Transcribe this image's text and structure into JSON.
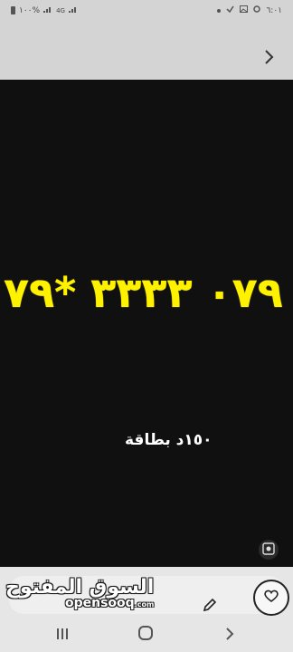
{
  "status_bar": {
    "time": "٦:٠١",
    "battery": "١٠٠%",
    "network": "4G"
  },
  "content": {
    "phone_number": "٠٧٩ ٣٣٣٣ *٧٩",
    "price": "١٥٠د بطاقة"
  },
  "brand": {
    "arabic": "السوق المفتوح",
    "latin": "opensooq",
    "latin_suffix": ".com"
  },
  "colors": {
    "number": "#fff200",
    "background": "#101010"
  },
  "icons": {
    "next": "chevron-right-icon",
    "lens": "lens-icon",
    "edit": "pencil-icon",
    "favorite": "heart-icon"
  }
}
